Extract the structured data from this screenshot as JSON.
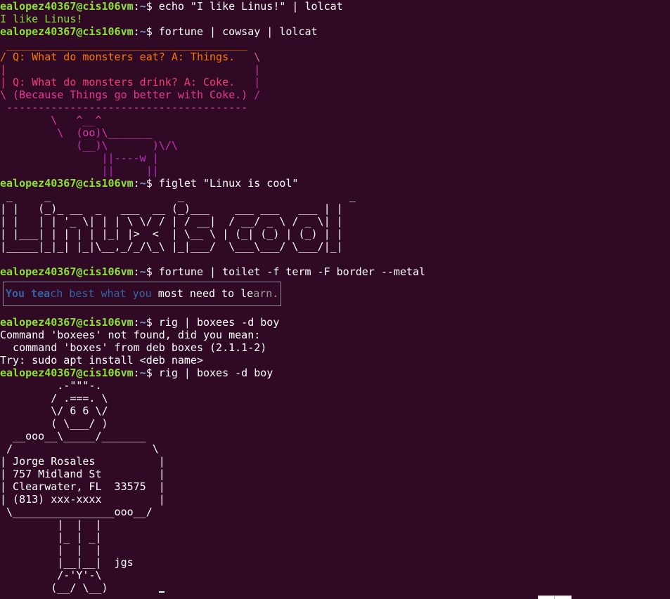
{
  "prompt": {
    "user": "ealopez40367",
    "at": "@",
    "host": "cis106vm",
    "sep": ":",
    "path": "~",
    "symbol": "$ "
  },
  "blocks": [
    {
      "type": "prompt",
      "command": "echo \"I like Linus!\" | lolcat"
    },
    {
      "type": "output",
      "segments": [
        {
          "text": "I like Linus!",
          "color": "#8ae234"
        }
      ]
    },
    {
      "type": "prompt",
      "command": "fortune | cowsay | lolcat"
    },
    {
      "type": "output",
      "segments": [
        {
          "text": " ______________________________________",
          "color": "#f57900"
        }
      ]
    },
    {
      "type": "output",
      "segments": [
        {
          "text": "/ Q: What do monsters eat? A: Things.  ",
          "color": "#f57900"
        },
        {
          "text": " \\",
          "color": "#e06090"
        }
      ]
    },
    {
      "type": "output",
      "segments": [
        {
          "text": "|                                      ",
          "color": "#f0506e"
        },
        {
          "text": " |",
          "color": "#e040a0"
        }
      ]
    },
    {
      "type": "output",
      "segments": [
        {
          "text": "| Q: What do monsters drink? A: Coke. ",
          "color": "#f03c78"
        },
        {
          "text": "  |",
          "color": "#d030b0"
        }
      ]
    },
    {
      "type": "output",
      "segments": [
        {
          "text": "\\ (Because Things go better with Coke.)",
          "color": "#e83898"
        },
        {
          "text": " /",
          "color": "#c828c0"
        }
      ]
    },
    {
      "type": "output",
      "segments": [
        {
          "text": " --------------------------------------",
          "color": "#e040a8"
        }
      ]
    },
    {
      "type": "output",
      "segments": [
        {
          "text": "        \\   ^__^",
          "color": "#e03cb0"
        }
      ]
    },
    {
      "type": "output",
      "segments": [
        {
          "text": "         \\  (oo)\\_______",
          "color": "#d838b8"
        }
      ]
    },
    {
      "type": "output",
      "segments": [
        {
          "text": "            (__)\\       )\\/\\",
          "color": "#c830c4"
        }
      ]
    },
    {
      "type": "output",
      "segments": [
        {
          "text": "                ||----w |",
          "color": "#c02ccc"
        }
      ]
    },
    {
      "type": "output",
      "segments": [
        {
          "text": "                ||     ||",
          "color": "#b828d4"
        }
      ]
    },
    {
      "type": "prompt",
      "command": "figlet \"Linux is cool\""
    },
    {
      "type": "output",
      "segments": [
        {
          "text": " _     _                    _                          _ ",
          "color": "#ffffff"
        }
      ]
    },
    {
      "type": "output",
      "segments": [
        {
          "text": "| |   (_)_ __  _   ___  __ (_)___    ___ ___   ___ | |",
          "color": "#ffffff"
        }
      ]
    },
    {
      "type": "output",
      "segments": [
        {
          "text": "| |   | | '_ \\| | | \\ \\/ / | / __|  / __/ _ \\ / _ \\| |",
          "color": "#ffffff"
        }
      ]
    },
    {
      "type": "output",
      "segments": [
        {
          "text": "| |___| | | | | |_| |>  <  | \\__ \\ | (_| (_) | (_) | |",
          "color": "#ffffff"
        }
      ]
    },
    {
      "type": "output",
      "segments": [
        {
          "text": "|_____|_|_| |_|\\__,_/_/\\_\\ |_|___/  \\___\\___/ \\___/|_|",
          "color": "#ffffff"
        }
      ]
    },
    {
      "type": "output",
      "segments": [
        {
          "text": "",
          "color": "#ffffff"
        }
      ]
    },
    {
      "type": "prompt",
      "command": "fortune | toilet -f term -F border --metal"
    },
    {
      "type": "toilet",
      "segments": [
        {
          "text": "You tea",
          "color": "#3465a4",
          "bold": true
        },
        {
          "text": "ch best what you ",
          "color": "#3465a4",
          "bold": false
        },
        {
          "text": "most need to le",
          "color": "#ffffff",
          "bold": false
        },
        {
          "text": "arn.",
          "color": "#a0a0a0",
          "bold": false
        }
      ]
    },
    {
      "type": "prompt",
      "command": "rig | boxees -d boy"
    },
    {
      "type": "output",
      "segments": [
        {
          "text": "Command 'boxees' not found, did you mean:",
          "color": "#ffffff"
        }
      ]
    },
    {
      "type": "output",
      "segments": [
        {
          "text": "  command 'boxes' from deb boxes (2.1.1-2)",
          "color": "#ffffff"
        }
      ]
    },
    {
      "type": "output",
      "segments": [
        {
          "text": "Try: sudo apt install <deb name>",
          "color": "#ffffff"
        }
      ]
    },
    {
      "type": "prompt",
      "command": "rig | boxes -d boy"
    },
    {
      "type": "output",
      "segments": [
        {
          "text": "         .-\"\"\"-.",
          "color": "#ffffff"
        }
      ]
    },
    {
      "type": "output",
      "segments": [
        {
          "text": "        / .===. \\",
          "color": "#ffffff"
        }
      ]
    },
    {
      "type": "output",
      "segments": [
        {
          "text": "        \\/ 6 6 \\/",
          "color": "#ffffff"
        }
      ]
    },
    {
      "type": "output",
      "segments": [
        {
          "text": "        ( \\___/ )",
          "color": "#ffffff"
        }
      ]
    },
    {
      "type": "output",
      "segments": [
        {
          "text": "  __ooo__\\_____/_______",
          "color": "#ffffff"
        }
      ]
    },
    {
      "type": "output",
      "segments": [
        {
          "text": " /                      \\",
          "color": "#ffffff"
        }
      ]
    },
    {
      "type": "output",
      "segments": [
        {
          "text": "| Jorge Rosales          |",
          "color": "#ffffff"
        }
      ]
    },
    {
      "type": "output",
      "segments": [
        {
          "text": "| 757 Midland St         |",
          "color": "#ffffff"
        }
      ]
    },
    {
      "type": "output",
      "segments": [
        {
          "text": "| Clearwater, FL  33575  |",
          "color": "#ffffff"
        }
      ]
    },
    {
      "type": "output",
      "segments": [
        {
          "text": "| (813) xxx-xxxx         |",
          "color": "#ffffff"
        }
      ]
    },
    {
      "type": "output",
      "segments": [
        {
          "text": " \\________________ooo__/",
          "color": "#ffffff"
        }
      ]
    },
    {
      "type": "output",
      "segments": [
        {
          "text": "         |  |  |",
          "color": "#ffffff"
        }
      ]
    },
    {
      "type": "output",
      "segments": [
        {
          "text": "         |_ | _|",
          "color": "#ffffff"
        }
      ]
    },
    {
      "type": "output",
      "segments": [
        {
          "text": "         |  |  |",
          "color": "#ffffff"
        }
      ]
    },
    {
      "type": "output",
      "segments": [
        {
          "text": "         |__|__|  jgs",
          "color": "#ffffff"
        }
      ]
    },
    {
      "type": "output",
      "segments": [
        {
          "text": "         /-'Y'-\\",
          "color": "#ffffff"
        }
      ]
    },
    {
      "type": "output",
      "segments": [
        {
          "text": "        (__/ \\__)",
          "color": "#ffffff"
        }
      ]
    }
  ],
  "colors": {
    "background": "#300a24",
    "prompt_user": "#8ae234",
    "prompt_path": "#729fcf",
    "foreground": "#ffffff"
  }
}
